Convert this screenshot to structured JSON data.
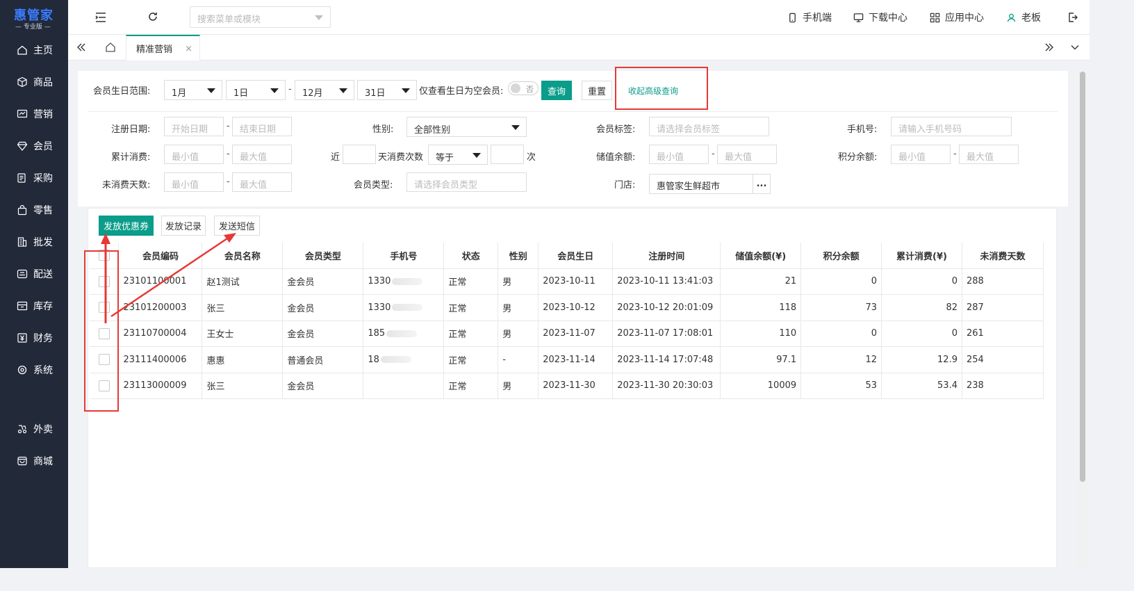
{
  "brand": {
    "name": "惠管家",
    "edition": "专业版"
  },
  "sidebar": {
    "items": [
      {
        "label": "主页",
        "icon": "home-icon"
      },
      {
        "label": "商品",
        "icon": "cube-icon"
      },
      {
        "label": "营销",
        "icon": "marketing-icon"
      },
      {
        "label": "会员",
        "icon": "diamond-icon"
      },
      {
        "label": "采购",
        "icon": "purchase-icon"
      },
      {
        "label": "零售",
        "icon": "bag-icon"
      },
      {
        "label": "批发",
        "icon": "building-icon"
      },
      {
        "label": "配送",
        "icon": "truck-icon"
      },
      {
        "label": "库存",
        "icon": "inventory-icon"
      },
      {
        "label": "财务",
        "icon": "yen-icon"
      },
      {
        "label": "系统",
        "icon": "gear-icon"
      },
      {
        "label": "外卖",
        "icon": "takeout-icon"
      },
      {
        "label": "商城",
        "icon": "store-icon"
      }
    ]
  },
  "topbar": {
    "search_placeholder": "搜索菜单或模块",
    "mobile": "手机端",
    "downloads": "下载中心",
    "apps": "应用中心",
    "user": "老板"
  },
  "tabs": {
    "active": "精准营销",
    "close": "×"
  },
  "filters": {
    "birthday_label": "会员生日范围:",
    "birth_from_month": "1月",
    "birth_from_day": "1日",
    "range_dash": "-",
    "birth_to_month": "12月",
    "birth_to_day": "31日",
    "empty_birthday_label": "仅查看生日为空会员:",
    "toggle_text": "否",
    "query": "查询",
    "reset": "重置",
    "collapse": "收起高级查询",
    "reg_date_label": "注册日期:",
    "reg_start": "开始日期",
    "reg_end": "结束日期",
    "gender_label": "性别:",
    "gender_value": "全部性别",
    "tag_label": "会员标签:",
    "tag_placeholder": "请选择会员标签",
    "phone_label": "手机号:",
    "phone_placeholder": "请输入手机号码",
    "total_spend_label": "累计消费:",
    "min": "最小值",
    "max": "最大值",
    "near": "近",
    "days_count_label": "天消费次数",
    "equals": "等于",
    "times": "次",
    "stored_label": "储值余额:",
    "points_label": "积分余额:",
    "inactive_label": "未消费天数:",
    "member_type_label": "会员类型:",
    "member_type_placeholder": "请选择会员类型",
    "store_label": "门店:",
    "store_value": "惠管家生鲜超市",
    "store_more": "..."
  },
  "actions": {
    "coupon": "发放优惠券",
    "records": "发放记录",
    "sms": "发送短信"
  },
  "table": {
    "headers": [
      "会员编码",
      "会员名称",
      "会员类型",
      "手机号",
      "状态",
      "性别",
      "会员生日",
      "注册时间",
      "储值余额(¥)",
      "积分余额",
      "累计消费(¥)",
      "未消费天数"
    ],
    "rows": [
      {
        "code": "23101100001",
        "name": "赵1测试",
        "type": "金会员",
        "phone": "1330",
        "status": "正常",
        "gender": "男",
        "birthday": "2023-10-11",
        "reg_time": "2023-10-11 13:41:03",
        "stored": "21",
        "points": "0",
        "spend": "0",
        "days": "288"
      },
      {
        "code": "23101200003",
        "name": "张三",
        "type": "金会员",
        "phone": "1330",
        "status": "正常",
        "gender": "男",
        "birthday": "2023-10-12",
        "reg_time": "2023-10-12 20:01:09",
        "stored": "118",
        "points": "73",
        "spend": "82",
        "days": "287"
      },
      {
        "code": "23110700004",
        "name": "王女士",
        "type": "金会员",
        "phone": "185",
        "status": "正常",
        "gender": "男",
        "birthday": "2023-11-07",
        "reg_time": "2023-11-07 17:08:01",
        "stored": "110",
        "points": "0",
        "spend": "0",
        "days": "261"
      },
      {
        "code": "23111400006",
        "name": "惠惠",
        "type": "普通会员",
        "phone": "18",
        "status": "正常",
        "gender": "-",
        "birthday": "2023-11-14",
        "reg_time": "2023-11-14 17:07:48",
        "stored": "97.1",
        "points": "12",
        "spend": "12.9",
        "days": "254"
      },
      {
        "code": "23113000009",
        "name": "张三",
        "type": "金会员",
        "phone": "",
        "status": "正常",
        "gender": "男",
        "birthday": "2023-11-30",
        "reg_time": "2023-11-30 20:30:03",
        "stored": "10009",
        "points": "53",
        "spend": "53.4",
        "days": "238"
      }
    ]
  },
  "colors": {
    "sidebar_bg": "#222a3a",
    "accent": "#0a9d8a",
    "annotation": "#e53935",
    "brand": "#3b7cff"
  }
}
